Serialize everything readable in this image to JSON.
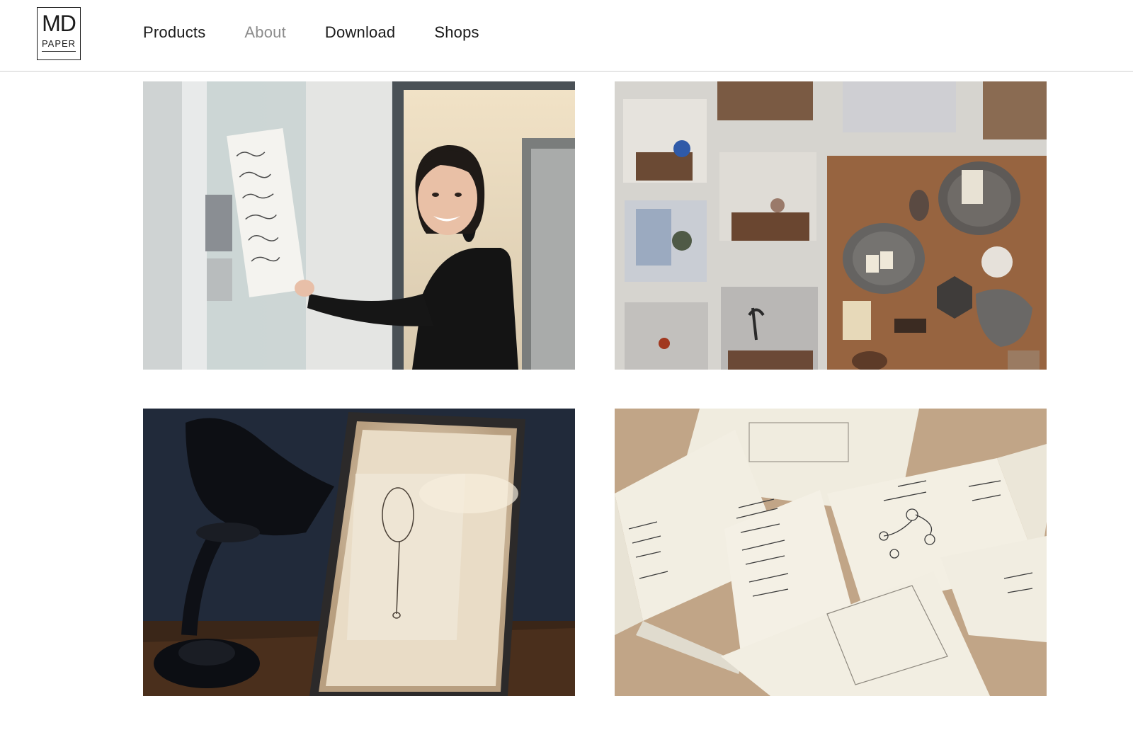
{
  "logo": {
    "line1": "MD",
    "line2": "PAPER"
  },
  "nav": {
    "items": [
      {
        "label": "Products",
        "active": false
      },
      {
        "label": "About",
        "active": true
      },
      {
        "label": "Download",
        "active": false
      },
      {
        "label": "Shops",
        "active": false
      }
    ]
  },
  "gallery": {
    "photos": [
      {
        "subject": "woman-holding-calligraphy-sheet"
      },
      {
        "subject": "wall-of-pinned-photographs"
      },
      {
        "subject": "desk-lamp-and-framed-calligraphy"
      },
      {
        "subject": "open-notebooks-with-sketches"
      }
    ]
  },
  "colors": {
    "text": "#1a1a1a",
    "nav_active": "#8c8c8c",
    "divider": "#cfcfcf"
  }
}
